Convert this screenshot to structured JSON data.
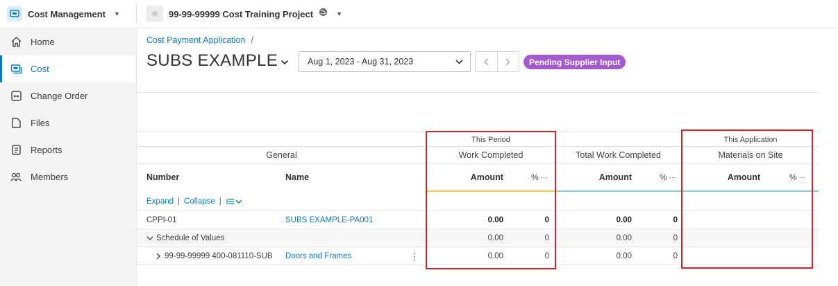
{
  "topbar": {
    "app_title": "Cost Management",
    "project_title": "99-99-99999 Cost Training Project"
  },
  "sidebar": {
    "items": [
      {
        "label": "Home",
        "icon": "home-icon",
        "active": false
      },
      {
        "label": "Cost",
        "icon": "cost-icon",
        "active": true
      },
      {
        "label": "Change Order",
        "icon": "change-order-icon",
        "active": false
      },
      {
        "label": "Files",
        "icon": "file-icon",
        "active": false
      },
      {
        "label": "Reports",
        "icon": "report-icon",
        "active": false
      },
      {
        "label": "Members",
        "icon": "members-icon",
        "active": false
      }
    ]
  },
  "header": {
    "breadcrumb_link": "Cost Payment Application",
    "breadcrumb_sep": "/",
    "title": "SUBS EXAMPLE",
    "period": "Aug 1, 2023 - Aug 31, 2023",
    "status": "Pending Supplier Input"
  },
  "table": {
    "groups": {
      "general": "General",
      "this_period": "This Period",
      "work_completed": "Work Completed",
      "total_work_completed": "Total Work Completed",
      "this_application": "This Application",
      "materials_on_site": "Materials on Site"
    },
    "columns": {
      "number": "Number",
      "name": "Name",
      "amount": "Amount",
      "pct": "%",
      "more": "···"
    },
    "toolbar": {
      "expand": "Expand",
      "divider": "|",
      "collapse": "Collapse"
    },
    "rows": [
      {
        "number": "CPPI-01",
        "name": "SUBS EXAMPLE-PA001",
        "wc_amount": "0.00",
        "wc_pct": "0",
        "twc_amount": "0.00",
        "twc_pct": "0"
      },
      {
        "number": "Schedule of Values",
        "name": "",
        "wc_amount": "0.00",
        "wc_pct": "0",
        "twc_amount": "0.00",
        "twc_pct": "0"
      },
      {
        "number": "99-99-99999 400-081110-SUB",
        "name": "Doors and Frames",
        "wc_amount": "0.00",
        "wc_pct": "0",
        "twc_amount": "0.00",
        "twc_pct": "0"
      }
    ]
  },
  "colors": {
    "accent": "#0b7bc2",
    "status_badge": "#a459d1",
    "highlight_box": "#d81f26",
    "this_period_underline": "#f3c84a",
    "total_underline": "#83d0c9"
  }
}
